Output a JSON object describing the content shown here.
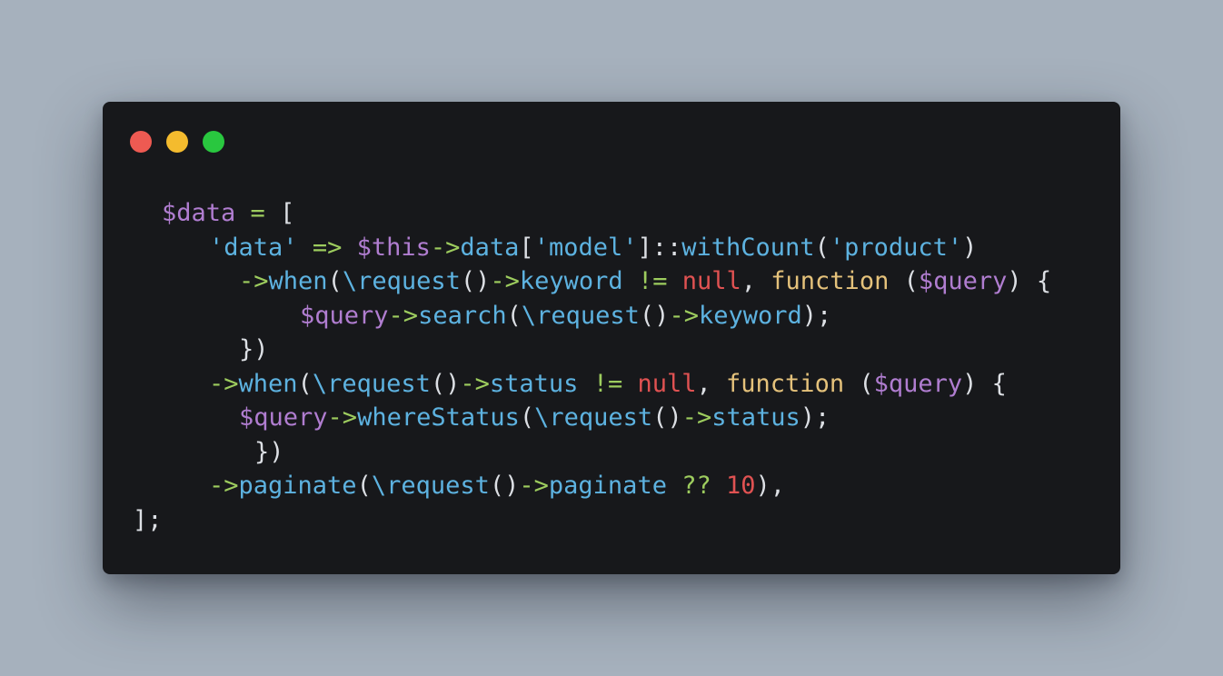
{
  "window": {
    "background": "#17181b",
    "controls": [
      {
        "name": "close",
        "color": "#ee5a52"
      },
      {
        "name": "minimize",
        "color": "#f4bb2e"
      },
      {
        "name": "maximize",
        "color": "#29c73f"
      }
    ]
  },
  "palette": {
    "variable": "#b07dd0",
    "plain": "#dcdfe4",
    "string": "#5db2e0",
    "operator": "#9dcc5e",
    "method": "#5db2e0",
    "keyword": "#e5c27b",
    "null": "#e05252",
    "number": "#e05252"
  },
  "code": {
    "lines": [
      {
        "indent": 65,
        "tokens": [
          {
            "t": "$data",
            "c": "variable"
          },
          {
            "t": " ",
            "c": "plain"
          },
          {
            "t": "=",
            "c": "operator"
          },
          {
            "t": " [",
            "c": "plain"
          }
        ]
      },
      {
        "indent": 117,
        "tokens": [
          {
            "t": "'data'",
            "c": "string"
          },
          {
            "t": " ",
            "c": "plain"
          },
          {
            "t": "=>",
            "c": "operator"
          },
          {
            "t": " ",
            "c": "plain"
          },
          {
            "t": "$this",
            "c": "variable"
          },
          {
            "t": "->",
            "c": "operator"
          },
          {
            "t": "data",
            "c": "method"
          },
          {
            "t": "[",
            "c": "plain"
          },
          {
            "t": "'model'",
            "c": "string"
          },
          {
            "t": "]::",
            "c": "plain"
          },
          {
            "t": "withCount",
            "c": "method"
          },
          {
            "t": "(",
            "c": "plain"
          },
          {
            "t": "'product'",
            "c": "string"
          },
          {
            "t": ")",
            "c": "plain"
          }
        ]
      },
      {
        "indent": 150,
        "tokens": [
          {
            "t": "->",
            "c": "operator"
          },
          {
            "t": "when",
            "c": "method"
          },
          {
            "t": "(",
            "c": "plain"
          },
          {
            "t": "\\request",
            "c": "method"
          },
          {
            "t": "()",
            "c": "plain"
          },
          {
            "t": "->",
            "c": "operator"
          },
          {
            "t": "keyword",
            "c": "method"
          },
          {
            "t": " ",
            "c": "plain"
          },
          {
            "t": "!=",
            "c": "operator"
          },
          {
            "t": " ",
            "c": "plain"
          },
          {
            "t": "null",
            "c": "null"
          },
          {
            "t": ", ",
            "c": "plain"
          },
          {
            "t": "function",
            "c": "keyword"
          },
          {
            "t": " (",
            "c": "plain"
          },
          {
            "t": "$query",
            "c": "variable"
          },
          {
            "t": ") {",
            "c": "plain"
          }
        ]
      },
      {
        "indent": 217,
        "tokens": [
          {
            "t": "$query",
            "c": "variable"
          },
          {
            "t": "->",
            "c": "operator"
          },
          {
            "t": "search",
            "c": "method"
          },
          {
            "t": "(",
            "c": "plain"
          },
          {
            "t": "\\request",
            "c": "method"
          },
          {
            "t": "()",
            "c": "plain"
          },
          {
            "t": "->",
            "c": "operator"
          },
          {
            "t": "keyword",
            "c": "method"
          },
          {
            "t": ");",
            "c": "plain"
          }
        ]
      },
      {
        "indent": 150,
        "tokens": [
          {
            "t": "})",
            "c": "plain"
          }
        ]
      },
      {
        "indent": 117,
        "tokens": [
          {
            "t": "->",
            "c": "operator"
          },
          {
            "t": "when",
            "c": "method"
          },
          {
            "t": "(",
            "c": "plain"
          },
          {
            "t": "\\request",
            "c": "method"
          },
          {
            "t": "()",
            "c": "plain"
          },
          {
            "t": "->",
            "c": "operator"
          },
          {
            "t": "status",
            "c": "method"
          },
          {
            "t": " ",
            "c": "plain"
          },
          {
            "t": "!=",
            "c": "operator"
          },
          {
            "t": " ",
            "c": "plain"
          },
          {
            "t": "null",
            "c": "null"
          },
          {
            "t": ", ",
            "c": "plain"
          },
          {
            "t": "function",
            "c": "keyword"
          },
          {
            "t": " (",
            "c": "plain"
          },
          {
            "t": "$query",
            "c": "variable"
          },
          {
            "t": ") {",
            "c": "plain"
          }
        ]
      },
      {
        "indent": 150,
        "tokens": [
          {
            "t": "$query",
            "c": "variable"
          },
          {
            "t": "->",
            "c": "operator"
          },
          {
            "t": "whereStatus",
            "c": "method"
          },
          {
            "t": "(",
            "c": "plain"
          },
          {
            "t": "\\request",
            "c": "method"
          },
          {
            "t": "()",
            "c": "plain"
          },
          {
            "t": "->",
            "c": "operator"
          },
          {
            "t": "status",
            "c": "method"
          },
          {
            "t": ");",
            "c": "plain"
          }
        ]
      },
      {
        "indent": 167,
        "tokens": [
          {
            "t": "})",
            "c": "plain"
          }
        ]
      },
      {
        "indent": 117,
        "tokens": [
          {
            "t": "->",
            "c": "operator"
          },
          {
            "t": "paginate",
            "c": "method"
          },
          {
            "t": "(",
            "c": "plain"
          },
          {
            "t": "\\request",
            "c": "method"
          },
          {
            "t": "()",
            "c": "plain"
          },
          {
            "t": "->",
            "c": "operator"
          },
          {
            "t": "paginate",
            "c": "method"
          },
          {
            "t": " ",
            "c": "plain"
          },
          {
            "t": "??",
            "c": "operator"
          },
          {
            "t": " ",
            "c": "plain"
          },
          {
            "t": "10",
            "c": "number"
          },
          {
            "t": "),",
            "c": "plain"
          }
        ]
      },
      {
        "indent": 33,
        "tokens": [
          {
            "t": "];",
            "c": "plain"
          }
        ]
      }
    ]
  }
}
